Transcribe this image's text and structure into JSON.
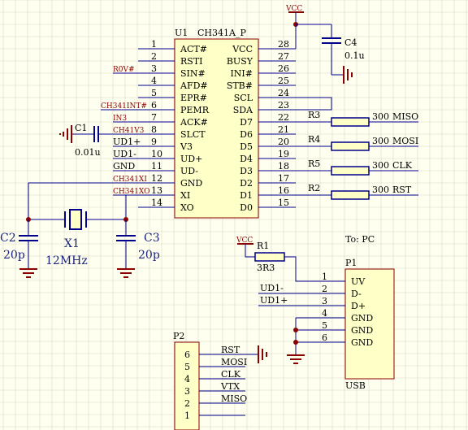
{
  "colors": {
    "background": "#fffff0",
    "grid": "#d8d8c8",
    "wire": "#00008b",
    "part_fill": "#ffffc8",
    "part_stroke": "#8b0000",
    "ground": "#8b0000",
    "net_label": "#8b0000",
    "text": "#000000",
    "value_text": "#1a237e"
  },
  "u1": {
    "ref": "U1",
    "name": "CH341A_P",
    "left_pins": [
      {
        "num": "1",
        "name": "ACT#"
      },
      {
        "num": "2",
        "name": "RSTI"
      },
      {
        "num": "3",
        "name": "SIN#"
      },
      {
        "num": "4",
        "name": "AFD#"
      },
      {
        "num": "5",
        "name": "EPR#"
      },
      {
        "num": "6",
        "name": "PEMR"
      },
      {
        "num": "7",
        "name": "ACK#"
      },
      {
        "num": "8",
        "name": "SLCT"
      },
      {
        "num": "9",
        "name": "V3"
      },
      {
        "num": "10",
        "name": "UD+"
      },
      {
        "num": "11",
        "name": "UD-"
      },
      {
        "num": "12",
        "name": "GND"
      },
      {
        "num": "13",
        "name": "XI"
      },
      {
        "num": "14",
        "name": "XO"
      }
    ],
    "right_pins": [
      {
        "num": "28",
        "name": "VCC"
      },
      {
        "num": "27",
        "name": "BUSY"
      },
      {
        "num": "26",
        "name": "INI#"
      },
      {
        "num": "25",
        "name": "STB#"
      },
      {
        "num": "24",
        "name": "SCL"
      },
      {
        "num": "23",
        "name": "SDA"
      },
      {
        "num": "22",
        "name": "D7"
      },
      {
        "num": "21",
        "name": "D6"
      },
      {
        "num": "20",
        "name": "D5"
      },
      {
        "num": "19",
        "name": "D4"
      },
      {
        "num": "18",
        "name": "D3"
      },
      {
        "num": "17",
        "name": "D2"
      },
      {
        "num": "16",
        "name": "D1"
      },
      {
        "num": "15",
        "name": "D0"
      }
    ]
  },
  "left_net_labels": {
    "row3": "R0V#",
    "row6": "CH341INT#",
    "row7": "IN3",
    "row8": "CH41V3",
    "row9": "UD1+",
    "row10": "UD1-",
    "row11": "GND",
    "row12": "CH341XI",
    "row13": "CH341XO"
  },
  "vcc": "VCC",
  "c4": {
    "ref": "C4",
    "value": "0.1u"
  },
  "c1": {
    "ref": "C1",
    "value": "0.01u"
  },
  "c2": {
    "ref": "C2",
    "value": "20p"
  },
  "c3": {
    "ref": "C3",
    "value": "20p"
  },
  "x1": {
    "ref": "X1",
    "value": "12MHz"
  },
  "resistors": [
    {
      "ref": "R3",
      "value": "300",
      "net": "MISO"
    },
    {
      "ref": "R4",
      "value": "300",
      "net": "MOSI"
    },
    {
      "ref": "R5",
      "value": "300",
      "net": "CLK"
    },
    {
      "ref": "R2",
      "value": "300",
      "net": "RST"
    }
  ],
  "r1": {
    "ref": "R1",
    "value": "3R3"
  },
  "usb_label": "To: PC",
  "p1": {
    "ref": "P1",
    "name": "USB",
    "pins": [
      {
        "num": "1",
        "name": "UV"
      },
      {
        "num": "2",
        "name": "D-"
      },
      {
        "num": "3",
        "name": "D+"
      },
      {
        "num": "4",
        "name": "GND"
      },
      {
        "num": "5",
        "name": "GND"
      },
      {
        "num": "6",
        "name": "GND"
      }
    ]
  },
  "p1_nets": {
    "pin2": "UD1-",
    "pin3": "UD1+"
  },
  "p2": {
    "ref": "P2",
    "pins": [
      {
        "num": "6",
        "net": "RST"
      },
      {
        "num": "5",
        "net": "MOSI"
      },
      {
        "num": "4",
        "net": "CLK"
      },
      {
        "num": "3",
        "net": "VTX"
      },
      {
        "num": "2",
        "net": "MISO"
      },
      {
        "num": "1",
        "net": ""
      }
    ]
  }
}
